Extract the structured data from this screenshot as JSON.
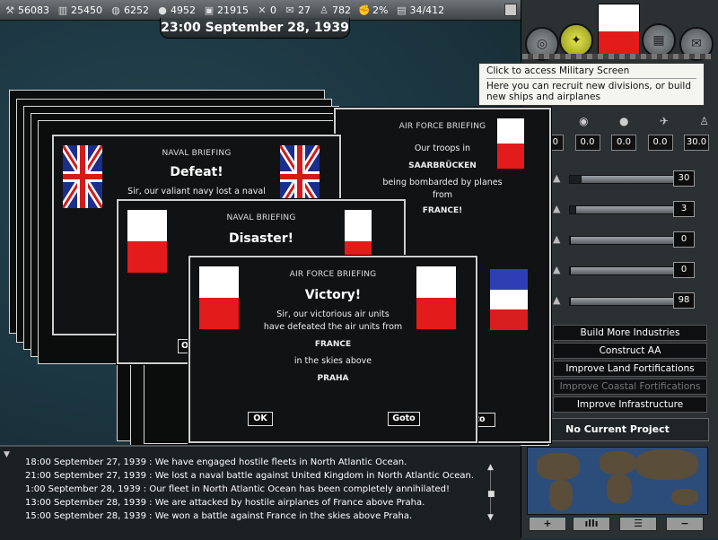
{
  "resources": [
    {
      "icon": "energy-icon",
      "value": "56083"
    },
    {
      "icon": "metal-icon",
      "value": "25450"
    },
    {
      "icon": "rare-materials-icon",
      "value": "6252"
    },
    {
      "icon": "oil-icon",
      "value": "4952"
    },
    {
      "icon": "supplies-icon",
      "value": "21915"
    },
    {
      "icon": "transport-icon",
      "value": "0"
    },
    {
      "icon": "money-icon",
      "value": "27"
    },
    {
      "icon": "manpower-icon",
      "value": "782"
    },
    {
      "icon": "dissent-icon",
      "value": "2%"
    },
    {
      "icon": "ic-icon",
      "value": "34/412"
    }
  ],
  "date": "23:00 September 28, 1939",
  "tooltip": {
    "title": "Click to access Military Screen",
    "body": "Here you can recruit new divisions, or build new ships and airplanes"
  },
  "production_values": [
    "0.0",
    "0.0",
    "0.0",
    "0.0",
    "30.0"
  ],
  "sliders": [
    {
      "icon": "supplies-slider-icon",
      "value": "30",
      "fill": 0.1
    },
    {
      "icon": "production-slider-icon",
      "value": "3",
      "fill": 0.05
    },
    {
      "icon": "upgrade-slider-icon",
      "value": "0",
      "fill": 0.0
    },
    {
      "icon": "reinforcement-slider-icon",
      "value": "0",
      "fill": 0.0
    },
    {
      "icon": "consumer-goods-slider-icon",
      "value": "98",
      "fill": 0.0
    }
  ],
  "projects": [
    {
      "label": "Build More Industries",
      "enabled": true
    },
    {
      "label": "Construct AA",
      "enabled": true
    },
    {
      "label": "Improve Land Fortifications",
      "enabled": true
    },
    {
      "label": "Improve Coastal Fortifications",
      "enabled": false
    },
    {
      "label": "Improve Infrastructure",
      "enabled": true
    }
  ],
  "no_project": "No Current Project",
  "map_controls": [
    "+",
    "",
    "",
    "−"
  ],
  "log": [
    "18:00 September 27, 1939 : We have engaged hostile fleets in North Atlantic Ocean.",
    "21:00 September 27, 1939 : We lost a naval battle against United Kingdom in North Atlantic Ocean.",
    "1:00 September 28, 1939 : Our fleet in North Atlantic Ocean has been completely annihilated!",
    "13:00 September 28, 1939 : We are attacked by hostile airplanes of France above Praha.",
    "15:00 September 28, 1939 : We won a battle against France in the skies above Praha."
  ],
  "briefings": {
    "air1": {
      "category": "AIR FORCE BRIEFING",
      "line1": "Our troops in",
      "place": "SAARBRÜCKEN",
      "line2": "being bombarded by planes",
      "line3": "from",
      "country": "FRANCE!"
    },
    "naval1": {
      "category": "NAVAL BRIEFING",
      "headline": "Defeat!",
      "line1": "Sir, our valiant navy lost a naval"
    },
    "naval2": {
      "category": "NAVAL BRIEFING",
      "headline": "Disaster!"
    },
    "air2": {
      "category": "AIR FORCE BRIEFING",
      "headline": "Victory!",
      "line1": "Sir, our victorious air units",
      "line2": "have defeated the air units from",
      "country": "FRANCE",
      "line3": "in the skies above",
      "place": "PRAHA",
      "ok": "OK",
      "goto": "Goto"
    },
    "partial_ok": "O",
    "partial_goto": "to"
  }
}
